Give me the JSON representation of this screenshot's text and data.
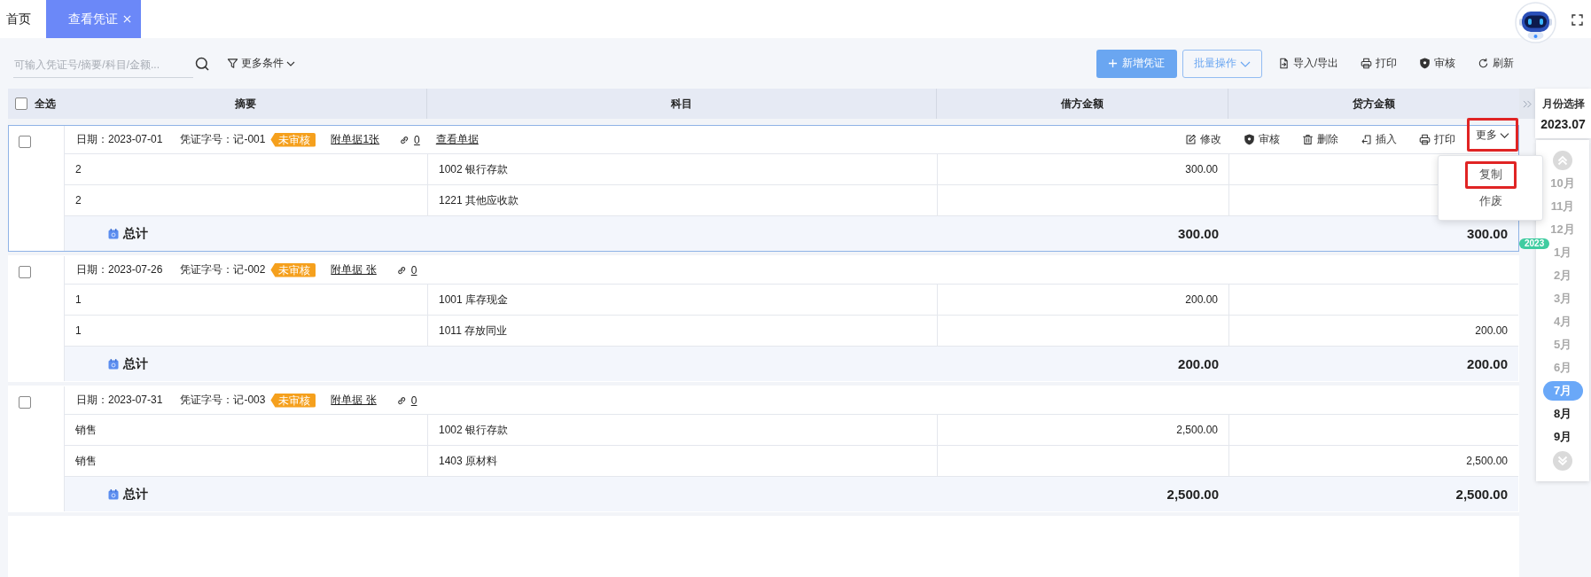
{
  "tabs": [
    {
      "label": "首页",
      "selected": false,
      "closable": false
    },
    {
      "label": "查看凭证",
      "selected": true,
      "closable": true
    }
  ],
  "toolbar": {
    "search": {
      "placeholder": "可输入凭证号/摘要/科目/金额..."
    },
    "filter": "更多条件",
    "actions": [
      {
        "label": "新增凭证",
        "kind": "primary"
      },
      {
        "label": "批量操作",
        "kind": "dropdown"
      },
      {
        "label": "导入/导出",
        "kind": "import"
      },
      {
        "label": "打印",
        "kind": "print"
      },
      {
        "label": "审核",
        "kind": "audit"
      },
      {
        "label": "刷新",
        "kind": "refresh"
      }
    ]
  },
  "table": {
    "select_all": {
      "label": "全选",
      "checked": false
    },
    "columns": [
      "摘要",
      "科目",
      "借方金额",
      "贷方金额"
    ]
  },
  "vouchers": [
    {
      "checked": false,
      "active": true,
      "date": "日期：2023-07-01",
      "number": "凭证字号：记-001",
      "status": "未审核",
      "attachments": "附单据1张",
      "link_count": "0",
      "view_link": "查看单据",
      "actions": [
        {
          "label": "修改",
          "kind": "edit",
          "highlighted": false
        },
        {
          "label": "审核",
          "kind": "audit",
          "highlighted": false
        },
        {
          "label": "删除",
          "kind": "delete",
          "highlighted": false
        },
        {
          "label": "插入",
          "kind": "insert",
          "highlighted": false
        },
        {
          "label": "打印",
          "kind": "print",
          "highlighted": false
        },
        {
          "label": "更多",
          "kind": "more",
          "highlighted": true
        }
      ],
      "more_menu": [
        {
          "label": "复制",
          "highlighted": true
        },
        {
          "label": "作废",
          "highlighted": false
        }
      ],
      "entries": [
        {
          "summary": "2",
          "subject": "1002 银行存款",
          "debit": "300.00"
        },
        {
          "summary": "2",
          "subject": "1221 其他应收款"
        }
      ],
      "total_label": "总计",
      "total_debit": "300.00",
      "total_credit": "300.00"
    },
    {
      "checked": false,
      "active": false,
      "date": "日期：2023-07-26",
      "number": "凭证字号：记-002",
      "status": "未审核",
      "attachments": "附单据 张",
      "link_count": "0",
      "entries": [
        {
          "summary": "1",
          "subject": "1001 库存现金",
          "debit": "200.00"
        },
        {
          "summary": "1",
          "subject": "1011 存放同业",
          "credit": "200.00"
        }
      ],
      "total_label": "总计",
      "total_debit": "200.00",
      "total_credit": "200.00"
    },
    {
      "checked": false,
      "active": false,
      "date": "日期：2023-07-31",
      "number": "凭证字号：记-003",
      "status": "未审核",
      "attachments": "附单据 张",
      "link_count": "0",
      "entries": [
        {
          "summary": "销售",
          "subject": "1002 银行存款",
          "debit": "2,500.00"
        },
        {
          "summary": "销售",
          "subject": "1403 原材料",
          "credit": "2,500.00"
        }
      ],
      "total_label": "总计",
      "total_debit": "2,500.00",
      "total_credit": "2,500.00"
    }
  ],
  "month_panel": {
    "title": "月份选择",
    "current": "2023.07",
    "months": [
      {
        "label": "10月",
        "selected": false,
        "muted": true
      },
      {
        "label": "11月",
        "selected": false,
        "muted": true
      },
      {
        "label": "12月",
        "selected": false,
        "muted": true
      },
      {
        "label": "1月",
        "selected": false,
        "muted": true,
        "year_badge": "2023"
      },
      {
        "label": "2月",
        "selected": false,
        "muted": true
      },
      {
        "label": "3月",
        "selected": false,
        "muted": true
      },
      {
        "label": "4月",
        "selected": false,
        "muted": true
      },
      {
        "label": "5月",
        "selected": false,
        "muted": true
      },
      {
        "label": "6月",
        "selected": false,
        "muted": true
      },
      {
        "label": "7月",
        "selected": true,
        "muted": false
      },
      {
        "label": "8月",
        "selected": false,
        "muted": false
      },
      {
        "label": "9月",
        "selected": false,
        "muted": false
      }
    ]
  }
}
